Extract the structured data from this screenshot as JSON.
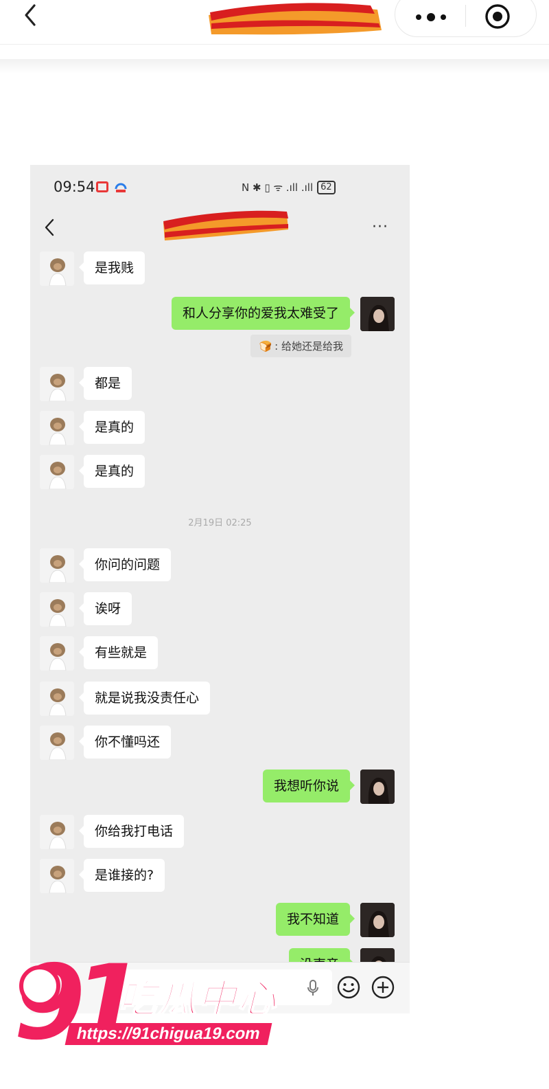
{
  "mini_program_bar": {
    "back_icon": "chevron-left-icon",
    "more_icon": "more-dots-icon",
    "close_icon": "target-circle-icon"
  },
  "phone": {
    "status": {
      "time": "09:54",
      "right_icons": "N ✱ ▯ ᯤ .ıll .ıll",
      "battery": "62"
    },
    "chat_header": {
      "back_icon": "chevron-left-icon",
      "more": "···"
    },
    "messages": [
      {
        "side": "left",
        "text": "是我贱"
      },
      {
        "side": "right",
        "text": "和人分享你的爱我太难受了"
      },
      {
        "side": "quote",
        "text": ": 给她还是给我"
      },
      {
        "side": "left",
        "text": "都是"
      },
      {
        "side": "left",
        "text": "是真的"
      },
      {
        "side": "left",
        "text": "是真的"
      },
      {
        "side": "time",
        "text": "2月19日 02:25"
      },
      {
        "side": "left",
        "text": "你问的问题"
      },
      {
        "side": "left",
        "text": "诶呀"
      },
      {
        "side": "left",
        "text": "有些就是"
      },
      {
        "side": "left",
        "text": "就是说我没责任心"
      },
      {
        "side": "left",
        "text": "你不懂吗还"
      },
      {
        "side": "right",
        "text": "我想听你说"
      },
      {
        "side": "left",
        "text": "你给我打电话"
      },
      {
        "side": "left",
        "text": "是谁接的?"
      },
      {
        "side": "right",
        "text": "我不知道"
      },
      {
        "side": "right",
        "text": "没声音"
      }
    ],
    "input_bar": {
      "mic_icon": "microphone-icon",
      "emoji_icon": "emoji-smile-icon",
      "plus_icon": "plus-circle-icon"
    }
  },
  "watermark": {
    "number": "91",
    "name": "吃瓜中心",
    "url": "https://91chigua19.com"
  },
  "colors": {
    "bubble_right": "#95ec69",
    "bubble_left": "#ffffff",
    "chat_bg": "#ededed",
    "watermark": "#f0215e"
  }
}
